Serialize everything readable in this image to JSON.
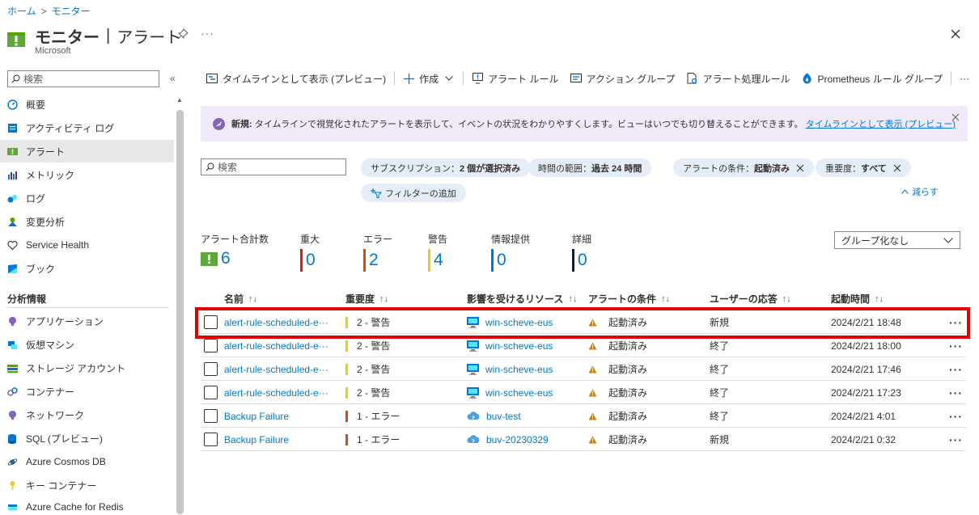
{
  "breadcrumb": {
    "home": "ホーム",
    "sep": ">",
    "current": "モニター"
  },
  "header": {
    "title_main": "モニター",
    "title_sep": "|",
    "title_sub": "アラート",
    "subtitle": "Microsoft",
    "more": "···"
  },
  "sidebar": {
    "search_placeholder": "検索",
    "collapse": "«",
    "items": [
      {
        "label": "概要",
        "icon": "overview-icon"
      },
      {
        "label": "アクティビティ ログ",
        "icon": "activity-log-icon"
      },
      {
        "label": "アラート",
        "icon": "alerts-icon",
        "active": true
      },
      {
        "label": "メトリック",
        "icon": "metrics-icon"
      },
      {
        "label": "ログ",
        "icon": "logs-icon"
      },
      {
        "label": "変更分析",
        "icon": "change-analysis-icon"
      },
      {
        "label": "Service Health",
        "icon": "heart-icon"
      },
      {
        "label": "ブック",
        "icon": "workbook-icon"
      }
    ],
    "section_title": "分析情報",
    "insights": [
      {
        "label": "アプリケーション",
        "icon": "application-icon"
      },
      {
        "label": "仮想マシン",
        "icon": "vm-icon"
      },
      {
        "label": "ストレージ アカウント",
        "icon": "storage-icon"
      },
      {
        "label": "コンテナー",
        "icon": "container-icon"
      },
      {
        "label": "ネットワーク",
        "icon": "network-icon"
      },
      {
        "label": "SQL (プレビュー)",
        "icon": "sql-icon"
      },
      {
        "label": "Azure Cosmos DB",
        "icon": "cosmos-icon"
      },
      {
        "label": "キー コンテナー",
        "icon": "key-icon"
      },
      {
        "label": "Azure Cache for Redis",
        "icon": "redis-icon"
      }
    ]
  },
  "toolbar": {
    "timeline": "タイムラインとして表示 (プレビュー)",
    "create": "作成",
    "alert_rule": "アラート ルール",
    "action_group": "アクション グループ",
    "processing_rule": "アラート処理ルール",
    "prometheus": "Prometheus ルール グループ",
    "more": "···"
  },
  "banner": {
    "new_label": "新規:",
    "text": "タイムラインで視覚化されたアラートを表示して、イベントの状況をわかりやすくします。ビューはいつでも切り替えることができます。",
    "link": "タイムラインとして表示 (プレビュー)"
  },
  "filters": {
    "search_placeholder": "検索",
    "subscription_key": "サブスクリプション：",
    "subscription_val": "2 個が選択済み",
    "time_key": "時間の範囲：",
    "time_val": "過去 24 時間",
    "condition_key": "アラートの条件：",
    "condition_val": "起動済み",
    "severity_key": "重要度：",
    "severity_val": "すべて",
    "add_filter": "フィルターの追加",
    "reduce": "減らす"
  },
  "summary": {
    "total_label": "アラート合計数",
    "total": "6",
    "critical_label": "重大",
    "critical": "0",
    "error_label": "エラー",
    "error": "2",
    "warning_label": "警告",
    "warning": "4",
    "info_label": "情報提供",
    "info": "0",
    "verbose_label": "詳細",
    "verbose": "0",
    "group_by": "グループ化なし"
  },
  "table": {
    "columns": [
      "名前",
      "重要度",
      "影響を受けるリソース",
      "アラートの条件",
      "ユーザーの応答",
      "起動時間"
    ],
    "sort_glyph": "↑↓",
    "rows": [
      {
        "name": "alert-rule-scheduled-e···",
        "severity": "2 - 警告",
        "sev_color": "#f2c811",
        "resource": "win-scheve-eus",
        "res_type": "vm",
        "condition": "起動済み",
        "response": "新規",
        "time": "2024/2/21 18:48"
      },
      {
        "name": "alert-rule-scheduled-e···",
        "severity": "2 - 警告",
        "sev_color": "#f2c811",
        "resource": "win-scheve-eus",
        "res_type": "vm",
        "condition": "起動済み",
        "response": "終了",
        "time": "2024/2/21 18:00"
      },
      {
        "name": "alert-rule-scheduled-e···",
        "severity": "2 - 警告",
        "sev_color": "#f2c811",
        "resource": "win-scheve-eus",
        "res_type": "vm",
        "condition": "起動済み",
        "response": "終了",
        "time": "2024/2/21 17:46"
      },
      {
        "name": "alert-rule-scheduled-e···",
        "severity": "2 - 警告",
        "sev_color": "#f2c811",
        "resource": "win-scheve-eus",
        "res_type": "vm",
        "condition": "起動済み",
        "response": "終了",
        "time": "2024/2/21 17:23"
      },
      {
        "name": "Backup Failure",
        "severity": "1 - エラー",
        "sev_color": "#ca5010",
        "resource": "buv-test",
        "res_type": "vault",
        "condition": "起動済み",
        "response": "終了",
        "time": "2024/2/21 4:01"
      },
      {
        "name": "Backup Failure",
        "severity": "1 - エラー",
        "sev_color": "#ca5010",
        "resource": "buv-20230329",
        "res_type": "vault",
        "condition": "起動済み",
        "response": "新規",
        "time": "2024/2/21 0:32"
      }
    ],
    "row_more": "···"
  },
  "colors": {
    "accent": "#0078d4",
    "critical": "#e81123",
    "error": "#ca5010",
    "warning": "#f2c811",
    "info": "#0078d4",
    "verbose": "#002050",
    "highlight": "#e00000"
  }
}
